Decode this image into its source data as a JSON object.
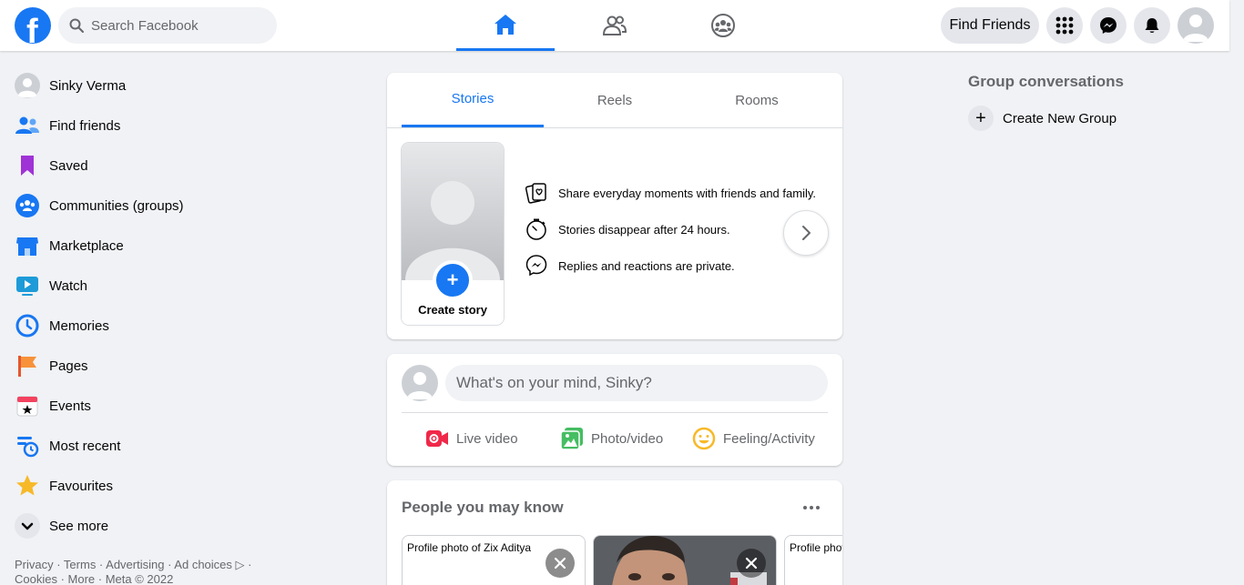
{
  "colors": {
    "accent": "#1877f2",
    "background": "#f0f2f5",
    "secondary_text": "#65676b"
  },
  "header": {
    "logo_letter": "f",
    "search_placeholder": "Search Facebook",
    "nav_tabs": [
      {
        "id": "home",
        "icon": "home-icon",
        "active": true
      },
      {
        "id": "friends",
        "icon": "friends-icon",
        "active": false
      },
      {
        "id": "groups",
        "icon": "groups-icon",
        "active": false
      }
    ],
    "find_friends_label": "Find Friends",
    "right_icons": [
      "menu-grid-icon",
      "messenger-icon",
      "notifications-bell-icon",
      "profile-avatar"
    ]
  },
  "sidebar": {
    "items": [
      {
        "label": "Sinky Verma",
        "icon": "avatar"
      },
      {
        "label": "Find friends",
        "icon": "find-friends-icon"
      },
      {
        "label": "Saved",
        "icon": "saved-bookmark-icon"
      },
      {
        "label": "Communities (groups)",
        "icon": "communities-icon"
      },
      {
        "label": "Marketplace",
        "icon": "marketplace-icon"
      },
      {
        "label": "Watch",
        "icon": "watch-icon"
      },
      {
        "label": "Memories",
        "icon": "memories-clock-icon"
      },
      {
        "label": "Pages",
        "icon": "pages-flag-icon"
      },
      {
        "label": "Events",
        "icon": "events-calendar-icon"
      },
      {
        "label": "Most recent",
        "icon": "most-recent-icon"
      },
      {
        "label": "Favourites",
        "icon": "favourites-star-icon"
      },
      {
        "label": "See more",
        "icon": "chevron-down-icon"
      }
    ],
    "footer_line1": "Privacy · Terms · Advertising · Ad choices ▷ ·",
    "footer_line2": "Cookies · More · Meta © 2022"
  },
  "stories": {
    "tabs": [
      {
        "label": "Stories",
        "active": true
      },
      {
        "label": "Reels",
        "active": false
      },
      {
        "label": "Rooms",
        "active": false
      }
    ],
    "create_story_label": "Create story",
    "create_story_plus": "+",
    "info": [
      {
        "text": "Share everyday moments with friends and family.",
        "icon": "story-card-heart-icon"
      },
      {
        "text": "Stories disappear after 24 hours.",
        "icon": "stopwatch-icon"
      },
      {
        "text": "Replies and reactions are private.",
        "icon": "messenger-icon"
      }
    ]
  },
  "composer": {
    "placeholder": "What's on your mind, Sinky?",
    "actions": [
      {
        "label": "Live video",
        "icon": "live-video-icon"
      },
      {
        "label": "Photo/video",
        "icon": "photo-video-icon"
      },
      {
        "label": "Feeling/Activity",
        "icon": "feeling-smiley-icon"
      }
    ]
  },
  "people_you_may_know": {
    "title": "People you may know",
    "people": [
      {
        "alt": "Profile photo of Zix Aditya",
        "has_photo": false
      },
      {
        "alt": "",
        "has_photo": true
      },
      {
        "alt": "Profile photo",
        "has_photo": false
      }
    ]
  },
  "right_rail": {
    "title": "Group conversations",
    "create_group_label": "Create New Group",
    "create_group_plus": "+"
  }
}
